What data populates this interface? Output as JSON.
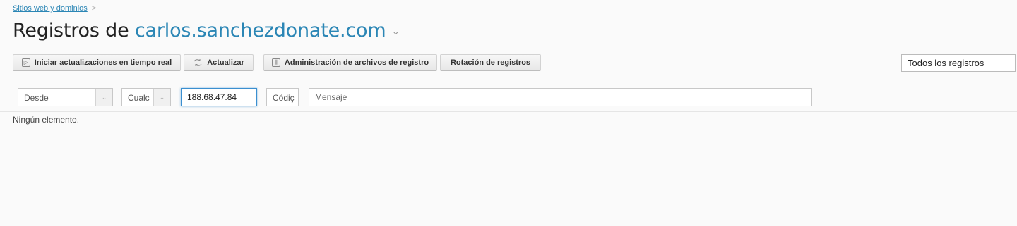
{
  "breadcrumb": {
    "link": "Sitios web y dominios",
    "sep": ">"
  },
  "title": {
    "prefix": "Registros de ",
    "domain": "carlos.sanchezdonate.com",
    "chevron": "⌄"
  },
  "toolbar": {
    "realtime": "Iniciar actualizaciones en tiempo real",
    "refresh": "Actualizar",
    "manage": "Administración de archivos de registro",
    "rotation": "Rotación de registros"
  },
  "log_select": {
    "value": "Todos los registros"
  },
  "filters": {
    "from": "Desde",
    "type": "Cualc",
    "ip": "188.68.47.84",
    "code": "Códiç",
    "message_placeholder": "Mensaje"
  },
  "empty_text": "Ningún elemento."
}
